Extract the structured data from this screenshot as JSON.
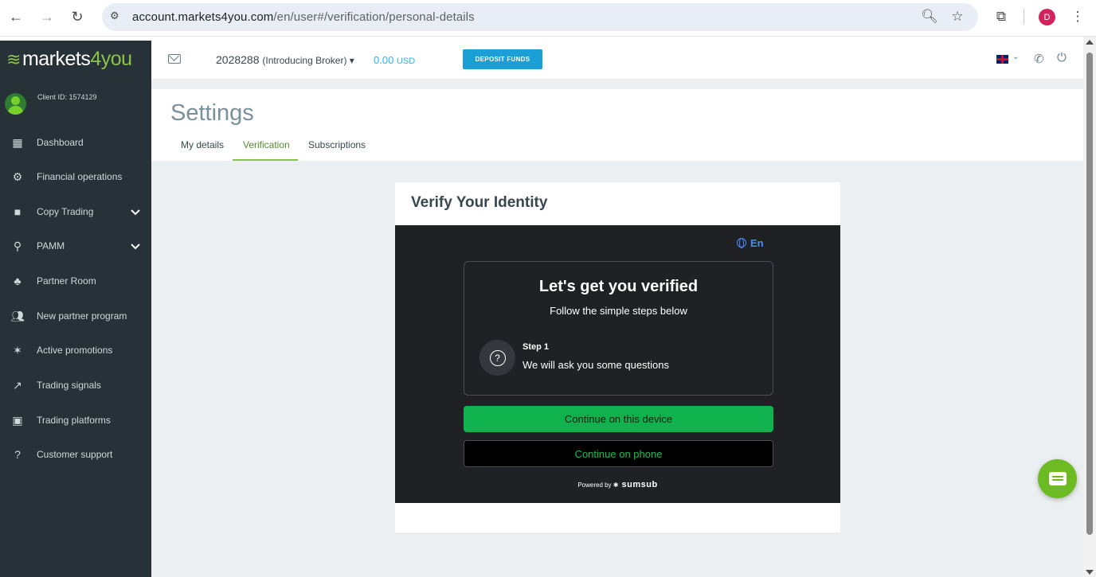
{
  "browser": {
    "url_host": "account.markets4you.com",
    "url_path": "/en/user#/verification/personal-details",
    "profile_initial": "D"
  },
  "sidebar": {
    "logo_prefix": "markets",
    "logo_num": "4",
    "logo_suffix": "you",
    "client_id": "Client ID: 1574129",
    "items": [
      {
        "label": "Dashboard",
        "icon": "dashboard-icon"
      },
      {
        "label": "Financial operations",
        "icon": "gear-icon"
      },
      {
        "label": "Copy Trading",
        "icon": "briefcase-icon"
      },
      {
        "label": "PAMM",
        "icon": "pamm-icon"
      },
      {
        "label": "Partner Room",
        "icon": "partner-icon"
      },
      {
        "label": "New partner program",
        "icon": "users-icon"
      },
      {
        "label": "Active promotions",
        "icon": "promo-icon"
      },
      {
        "label": "Trading signals",
        "icon": "trend-icon"
      },
      {
        "label": "Trading platforms",
        "icon": "platforms-icon"
      },
      {
        "label": "Customer support",
        "icon": "help-icon"
      }
    ]
  },
  "header": {
    "account_number": "2028288",
    "account_type": "(Introducing Broker)",
    "balance": "0.00",
    "currency": "USD",
    "deposit_label": "DEPOSIT FUNDS"
  },
  "settings": {
    "title": "Settings",
    "tabs": [
      "My details",
      "Verification",
      "Subscriptions"
    ],
    "active_tab": "Verification"
  },
  "verify": {
    "title": "Verify Your Identity",
    "language": "En",
    "heading": "Let's get you verified",
    "subheading": "Follow the simple steps below",
    "step_label": "Step 1",
    "step_text": "We will ask you some questions",
    "btn_device": "Continue on this device",
    "btn_phone": "Continue on phone",
    "powered_by": "Powered by",
    "brand": "sumsub"
  },
  "colors": {
    "sidebar_bg": "#263238",
    "accent_green": "#8bc34a",
    "deposit_blue": "#1a9fd6",
    "sumsub_bg": "#1f2125",
    "cta_green": "#0fb24c"
  }
}
